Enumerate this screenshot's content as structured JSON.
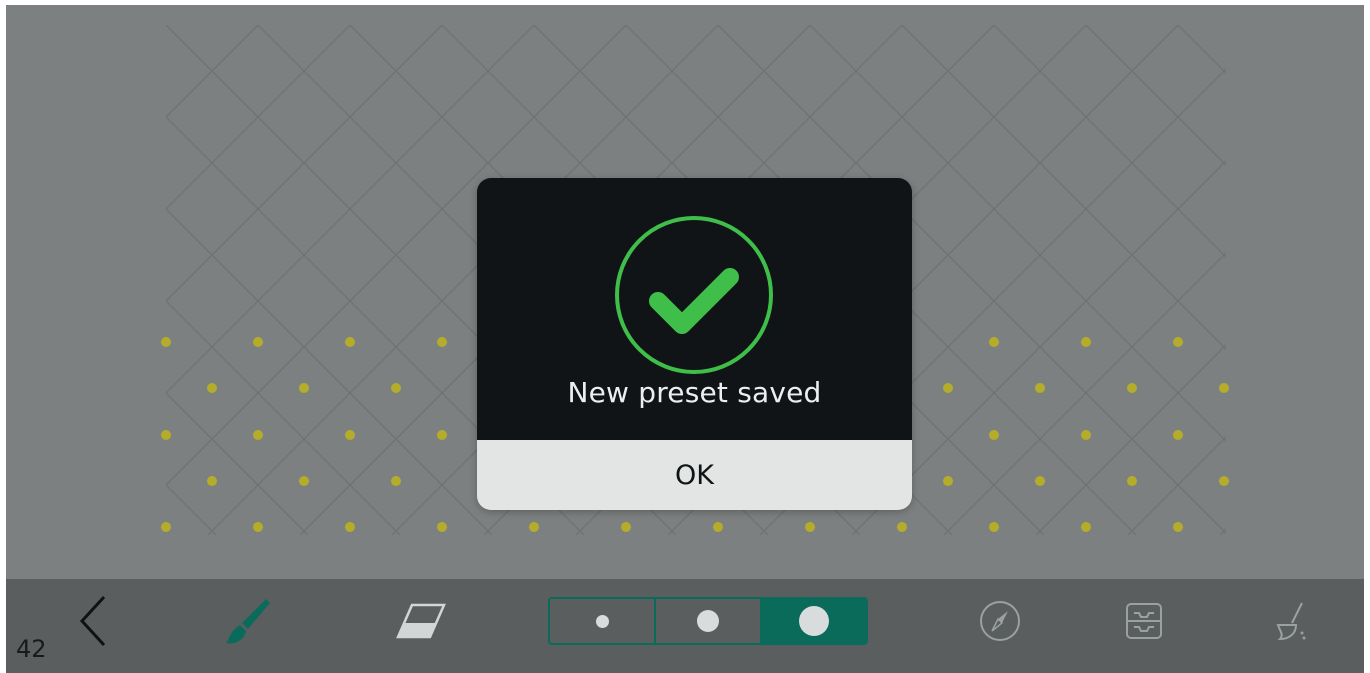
{
  "dialog": {
    "message": "New preset saved",
    "ok_label": "OK",
    "accent_color": "#3fbf4a"
  },
  "toolbar": {
    "page_number": "42",
    "accent_color": "#0b6b5a",
    "tools": [
      {
        "name": "back",
        "icon": "chevron-left-icon"
      },
      {
        "name": "brush",
        "icon": "paintbrush-icon",
        "selected": true
      },
      {
        "name": "eraser",
        "icon": "eraser-icon"
      },
      {
        "name": "compass",
        "icon": "compass-icon"
      },
      {
        "name": "presets",
        "icon": "tray-icon"
      },
      {
        "name": "clear",
        "icon": "broom-icon"
      }
    ],
    "brush_sizes": [
      {
        "size": "small",
        "selected": false
      },
      {
        "size": "medium",
        "selected": false
      },
      {
        "size": "large",
        "selected": true
      }
    ]
  },
  "canvas": {
    "background_color": "#7d8080",
    "line_color": "#6e7272",
    "dot_color": "#b5ad2a"
  }
}
